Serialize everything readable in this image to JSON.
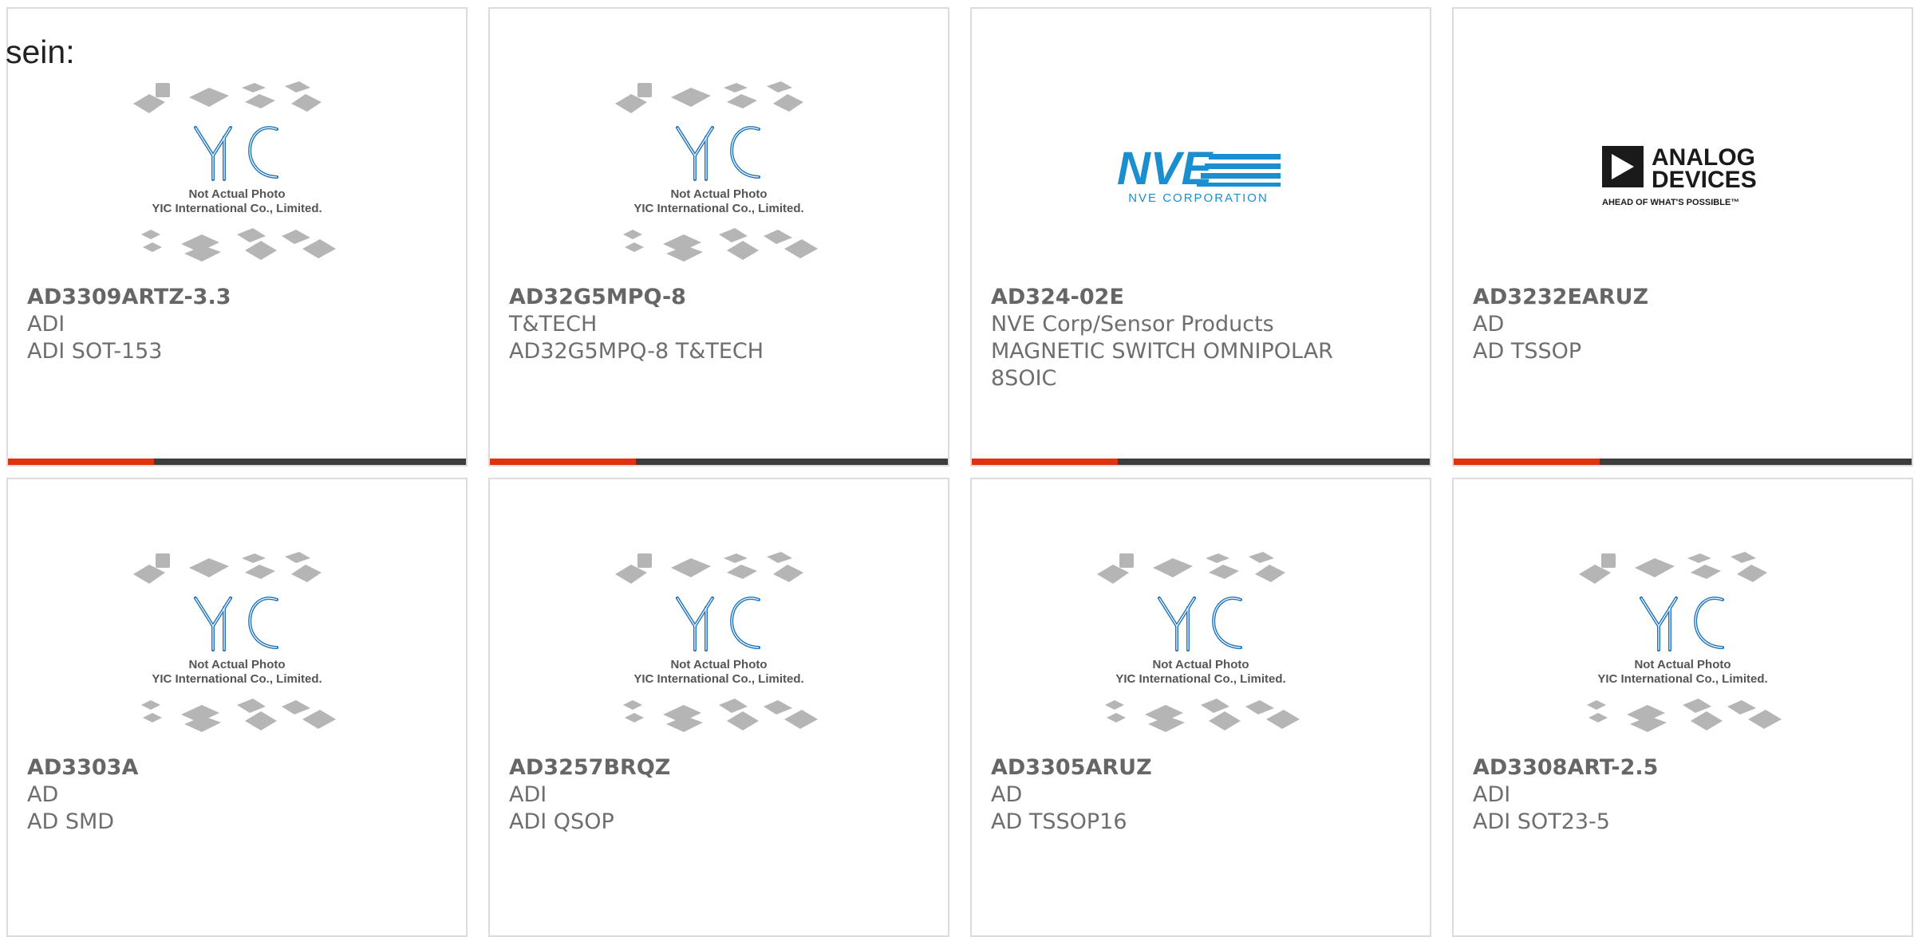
{
  "intro_text": "sein:",
  "colors": {
    "accent": "#e0320f",
    "bar": "#3d3d3d",
    "border": "#dcdcdc",
    "text": "#6e6e6e",
    "yic_blue": "#1e73be",
    "nve_blue": "#1b8ed0"
  },
  "placeholder": {
    "caption_line1": "Not Actual Photo",
    "caption_line2": "YIC International Co., Limited.",
    "logo_text": "YIC"
  },
  "nve_logo": {
    "mark": "NVE",
    "subtitle": "NVE CORPORATION"
  },
  "adi_logo": {
    "line1": "ANALOG",
    "line2": "DEVICES",
    "tagline": "AHEAD OF WHAT'S POSSIBLE™"
  },
  "products": [
    {
      "part": "AD3309ARTZ-3.3",
      "brand": "ADI",
      "desc": "ADI SOT-153",
      "image": "yic-placeholder"
    },
    {
      "part": "AD32G5MPQ-8",
      "brand": "T&TECH",
      "desc": "AD32G5MPQ-8 T&TECH",
      "image": "yic-placeholder"
    },
    {
      "part": "AD324-02E",
      "brand": "NVE Corp/Sensor Products",
      "desc": "MAGNETIC SWITCH OMNIPOLAR 8SOIC",
      "image": "nve-logo"
    },
    {
      "part": "AD3232EARUZ",
      "brand": "AD",
      "desc": "AD TSSOP",
      "image": "analog-devices-logo"
    },
    {
      "part": "AD3303A",
      "brand": "AD",
      "desc": "AD SMD",
      "image": "yic-placeholder"
    },
    {
      "part": "AD3257BRQZ",
      "brand": "ADI",
      "desc": "ADI QSOP",
      "image": "yic-placeholder"
    },
    {
      "part": "AD3305ARUZ",
      "brand": "AD",
      "desc": "AD TSSOP16",
      "image": "yic-placeholder"
    },
    {
      "part": "AD3308ART-2.5",
      "brand": "ADI",
      "desc": "ADI SOT23-5",
      "image": "yic-placeholder"
    }
  ]
}
